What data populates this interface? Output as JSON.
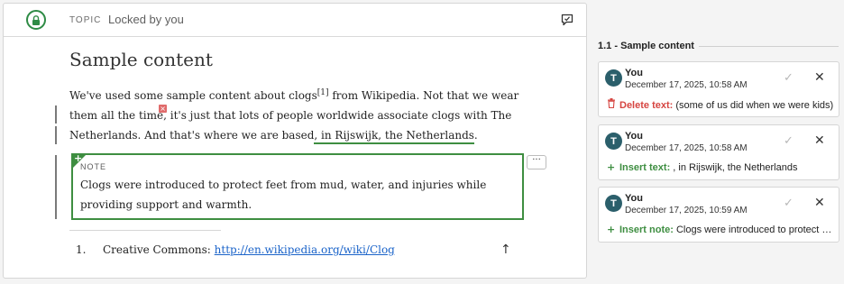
{
  "editor": {
    "topic_label": "TOPIC",
    "lock_status": "Locked by you",
    "title": "Sample content",
    "paragraph": {
      "part1": "We've used some sample content about clogs",
      "footnote_ref": "[1]",
      "part2": " from Wikipedia. Not that we wear them all the time",
      "deleted_marker": "×",
      "part3": ", it's just that lots of people worldwide associate clogs with The Netherlands. And that's where we are based",
      "inserted": ", in Rijswijk, the Netherlands",
      "part4": "."
    },
    "note": {
      "label": "NOTE",
      "corner_icon": "+",
      "text": "Clogs were introduced to protect feet from mud, water, and injuries while providing support and warmth."
    },
    "more_button": "···",
    "footnotes": [
      {
        "number": "1.",
        "text": "Creative Commons: ",
        "link": "http://en.wikipedia.org/wiki/Clog",
        "back": "↑"
      }
    ]
  },
  "review": {
    "title": "1.1 - Sample content",
    "cards": [
      {
        "avatar": "T",
        "author": "You",
        "date": "December 17, 2025, 10:58 AM",
        "icon": "trash-icon",
        "kind": "Delete text:",
        "detail": " (some of us did when we were kids)",
        "kind_color": "#d64541"
      },
      {
        "avatar": "T",
        "author": "You",
        "date": "December 17, 2025, 10:58 AM",
        "icon": "plus-icon",
        "kind": "Insert text:",
        "detail": " , in Rijswijk, the Netherlands",
        "kind_color": "#3e8e41"
      },
      {
        "avatar": "T",
        "author": "You",
        "date": "December 17, 2025, 10:59 AM",
        "icon": "plus-icon",
        "kind": "Insert note:",
        "detail": " Clogs were introduced to protect feet from mud, water, and injuries",
        "kind_color": "#3e8e41"
      }
    ],
    "accept_glyph": "✓",
    "reject_glyph": "✕",
    "plus_glyph": "+"
  },
  "colors": {
    "accent_green": "#3e8e41",
    "delete_red": "#d64541",
    "avatar_teal": "#2b5f6b",
    "link_blue": "#1a63c9"
  }
}
